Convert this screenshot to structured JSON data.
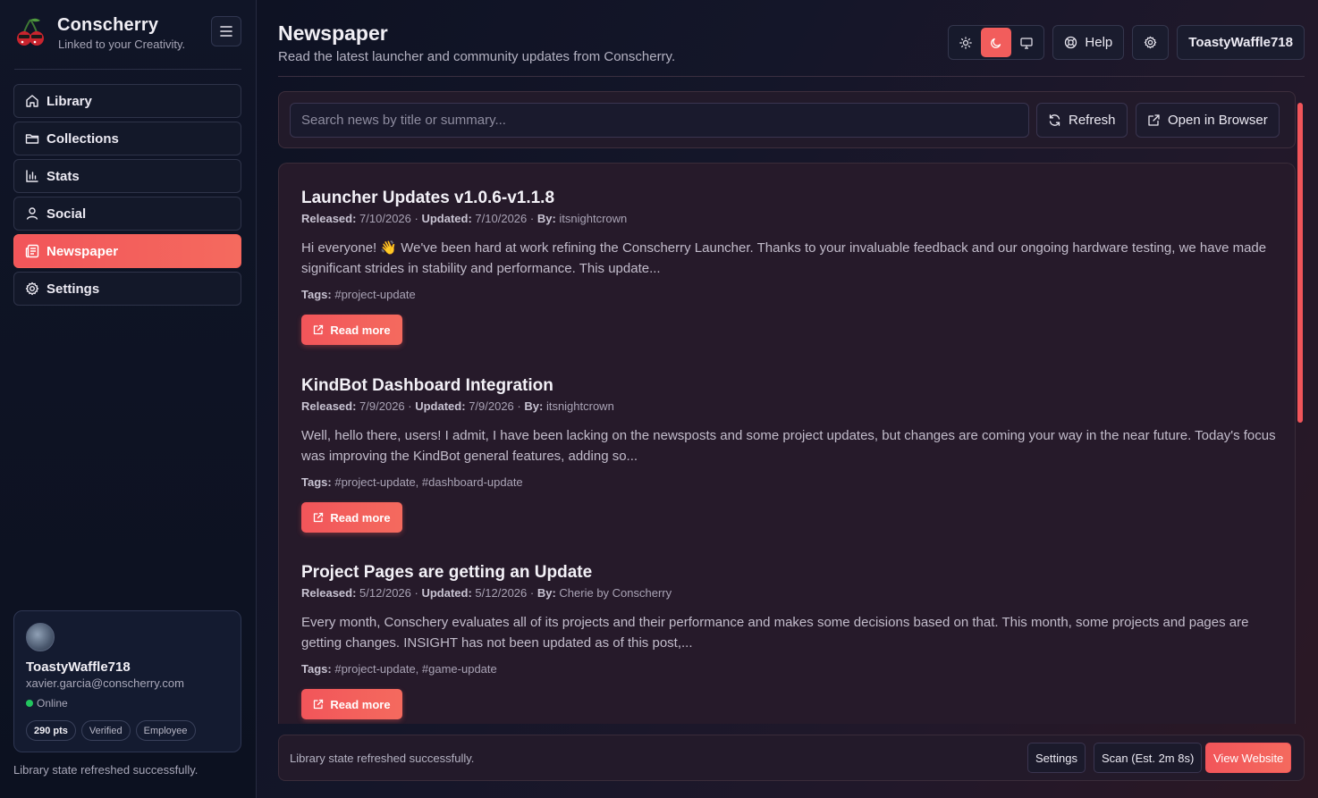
{
  "brand": {
    "name": "Conscherry",
    "tagline": "Linked to your Creativity."
  },
  "nav": [
    {
      "label": "Library",
      "icon": "home-icon"
    },
    {
      "label": "Collections",
      "icon": "folder-icon"
    },
    {
      "label": "Stats",
      "icon": "bar-chart-icon"
    },
    {
      "label": "Social",
      "icon": "user-icon"
    },
    {
      "label": "Newspaper",
      "icon": "newspaper-icon",
      "active": true
    },
    {
      "label": "Settings",
      "icon": "gear-icon"
    }
  ],
  "user_card": {
    "name": "ToastyWaffle718",
    "email": "xavier.garcia@conscherry.com",
    "status": "Online",
    "badges": [
      "290 pts",
      "Verified",
      "Employee"
    ]
  },
  "sidebar_status": "Library state refreshed successfully.",
  "header": {
    "title": "Newspaper",
    "subtitle": "Read the latest launcher and community updates from Conscherry.",
    "help_label": "Help",
    "user_label": "ToastyWaffle718",
    "theme_active": "dark"
  },
  "search": {
    "placeholder": "Search news by title or summary...",
    "value": "",
    "refresh_label": "Refresh",
    "open_browser_label": "Open in Browser"
  },
  "articles": [
    {
      "title": "Launcher Updates v1.0.6-v1.1.8",
      "released": "7/10/2026",
      "updated": "7/10/2026",
      "by": "itsnightcrown",
      "summary": "Hi everyone! 👋 We've been hard at work refining the Conscherry Launcher. Thanks to your invaluable feedback and our ongoing hardware testing, we have made significant strides in stability and performance. This update...",
      "tags": "#project-update",
      "read_more": "Read more"
    },
    {
      "title": "KindBot Dashboard Integration",
      "released": "7/9/2026",
      "updated": "7/9/2026",
      "by": "itsnightcrown",
      "summary": "Well, hello there, users! I admit, I have been lacking on the newsposts and some project updates, but changes are coming your way in the near future. Today's focus was improving the KindBot general features, adding so...",
      "tags": "#project-update, #dashboard-update",
      "read_more": "Read more"
    },
    {
      "title": "Project Pages are getting an Update",
      "released": "5/12/2026",
      "updated": "5/12/2026",
      "by": "Cherie by Conscherry",
      "summary": "Every month, Conschery evaluates all of its projects and their performance and makes some decisions based on that. This month, some projects and pages are getting changes. INSIGHT has not been updated as of this post,...",
      "tags": "#project-update, #game-update",
      "read_more": "Read more"
    }
  ],
  "meta_labels": {
    "released": "Released:",
    "updated": "Updated:",
    "by": "By:",
    "tags": "Tags:",
    "sep": " · "
  },
  "bottom_bar": {
    "status": "Library state refreshed successfully.",
    "settings_label": "Settings",
    "scan_label": "Scan (Est. 2m 8s)",
    "website_label": "View Website"
  },
  "colors": {
    "accent": "#f2555a",
    "online": "#22c55e",
    "background": "#141629"
  }
}
